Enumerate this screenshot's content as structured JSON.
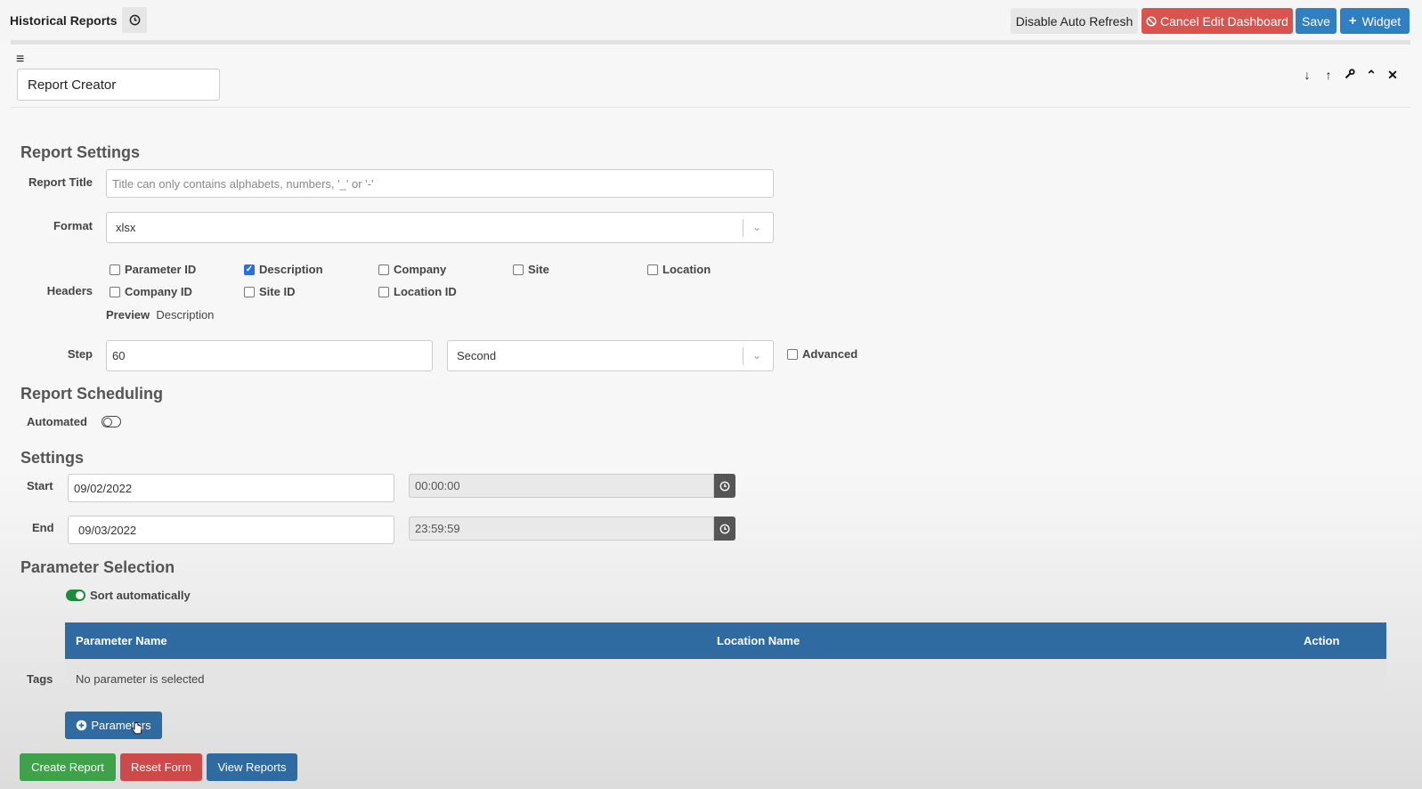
{
  "header": {
    "title": "Historical Reports",
    "disable_refresh": "Disable Auto Refresh",
    "cancel_edit": "Cancel Edit Dashboard",
    "save": "Save",
    "widget": "Widget"
  },
  "widget": {
    "title_value": "Report Creator"
  },
  "report_settings": {
    "heading": "Report Settings",
    "title_label": "Report Title",
    "title_placeholder": "Title can only contains alphabets, numbers, '_' or '-'",
    "format_label": "Format",
    "format_value": "xlsx",
    "headers_label": "Headers",
    "headers": [
      {
        "label": "Parameter ID",
        "checked": false
      },
      {
        "label": "Description",
        "checked": true
      },
      {
        "label": "Company",
        "checked": false
      },
      {
        "label": "Site",
        "checked": false
      },
      {
        "label": "Location",
        "checked": false
      },
      {
        "label": "Company ID",
        "checked": false
      },
      {
        "label": "Site ID",
        "checked": false
      },
      {
        "label": "Location ID",
        "checked": false
      }
    ],
    "preview_label": "Preview",
    "preview_value": "Description",
    "step_label": "Step",
    "step_value": "60",
    "step_unit": "Second",
    "advanced_label": "Advanced"
  },
  "scheduling": {
    "heading": "Report Scheduling",
    "automated_label": "Automated",
    "automated": false
  },
  "settings": {
    "heading": "Settings",
    "start_label": "Start",
    "start_date": "09/02/2022",
    "start_time": "00:00:00",
    "end_label": "End",
    "end_date": "09/03/2022",
    "end_time": "23:59:59"
  },
  "parameter_selection": {
    "heading": "Parameter Selection",
    "sort_label": "Sort automatically",
    "sort_enabled": true,
    "tags_label": "Tags",
    "columns": [
      "Parameter Name",
      "Location Name",
      "Action"
    ],
    "empty_message": "No parameter is selected",
    "add_button": "Parameters"
  },
  "footer": {
    "create": "Create Report",
    "reset": "Reset Form",
    "view": "View Reports"
  },
  "colors": {
    "primary": "#2f7fc1",
    "table_header": "#2f6aa0",
    "danger": "#d9534f",
    "success": "#3fa14a"
  }
}
